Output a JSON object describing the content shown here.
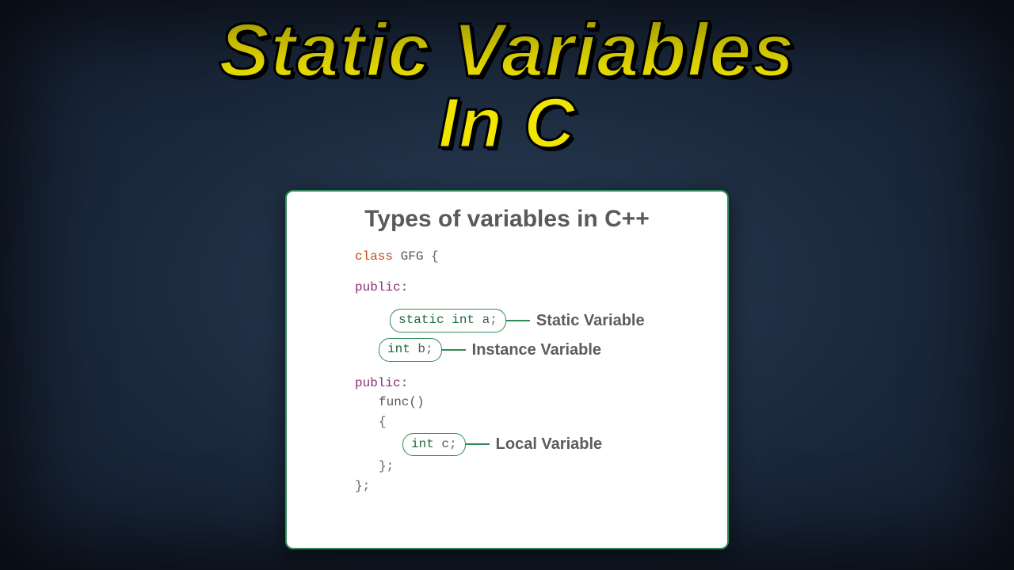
{
  "title": {
    "line1": "Static Variables",
    "line2": "In C"
  },
  "panel": {
    "heading": "Types of variables in C++",
    "code": {
      "class_kw": "class",
      "class_name": "GFG",
      "open_brace": "{",
      "close_brace": "};",
      "public1": "public:",
      "pill_a": "static int a;",
      "label_a": "Static Variable",
      "pill_b": "int b;",
      "label_b": "Instance Variable",
      "public2": "public:",
      "func_line": "func()",
      "func_open": "{",
      "pill_c": "int c;",
      "label_c": "Local Variable",
      "func_close": "};"
    }
  }
}
